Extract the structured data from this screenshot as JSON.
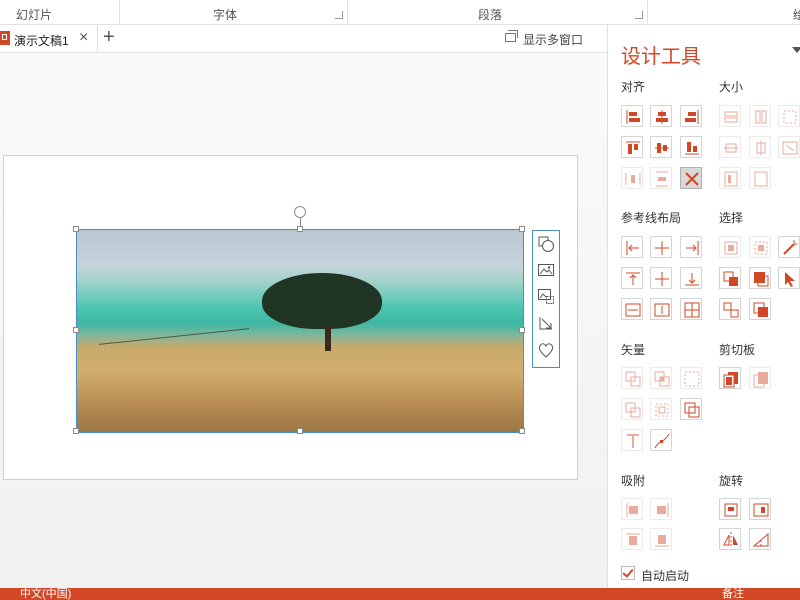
{
  "ribbon": {
    "groups": [
      {
        "label": "幻灯片"
      },
      {
        "label": "字体"
      },
      {
        "label": "段落"
      },
      {
        "label": "绘"
      }
    ]
  },
  "tabbar": {
    "doc_title": "演示文稿1",
    "close_glyph": "×",
    "add_glyph": "+",
    "multi_window": "显示多窗口"
  },
  "pane": {
    "title": "设计工具",
    "sections": {
      "align": "对齐",
      "size": "大小",
      "guides": "参考线布局",
      "select": "选择",
      "vector": "矢量",
      "clip": "剪切板",
      "snap": "吸附",
      "rotate": "旋转"
    },
    "auto_start": "自动启动"
  },
  "status": {
    "language": "中文(中国)",
    "notes": "备注"
  },
  "colors": {
    "accent": "#d24726",
    "selection": "#4a8fc4"
  }
}
